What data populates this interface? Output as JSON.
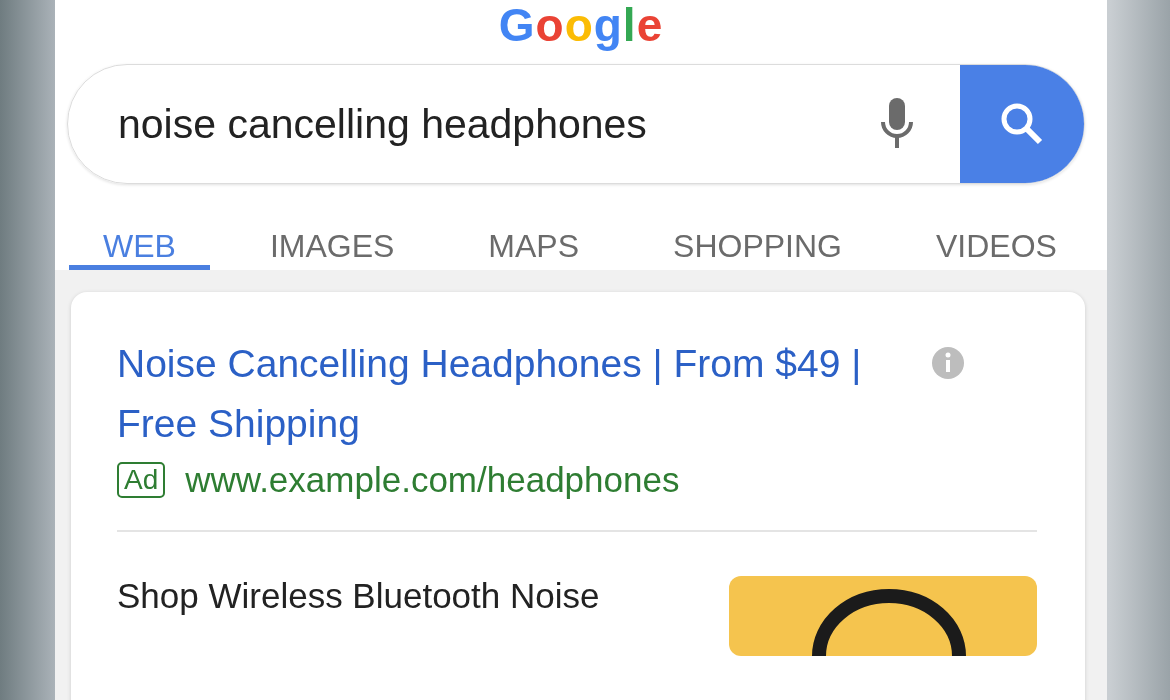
{
  "logo": {
    "text": "Google"
  },
  "search": {
    "value": "noise cancelling headphones"
  },
  "tabs": [
    {
      "label": "WEB",
      "selected": true
    },
    {
      "label": "IMAGES",
      "selected": false
    },
    {
      "label": "MAPS",
      "selected": false
    },
    {
      "label": "SHOPPING",
      "selected": false
    },
    {
      "label": "VIDEOS",
      "selected": false
    }
  ],
  "ad": {
    "title": "Noise Cancelling Headphones | From $49 | Free Shipping",
    "badge": "Ad",
    "url": "www.example.com/headphones"
  },
  "result": {
    "title": "Shop Wireless Bluetooth Noise"
  }
}
